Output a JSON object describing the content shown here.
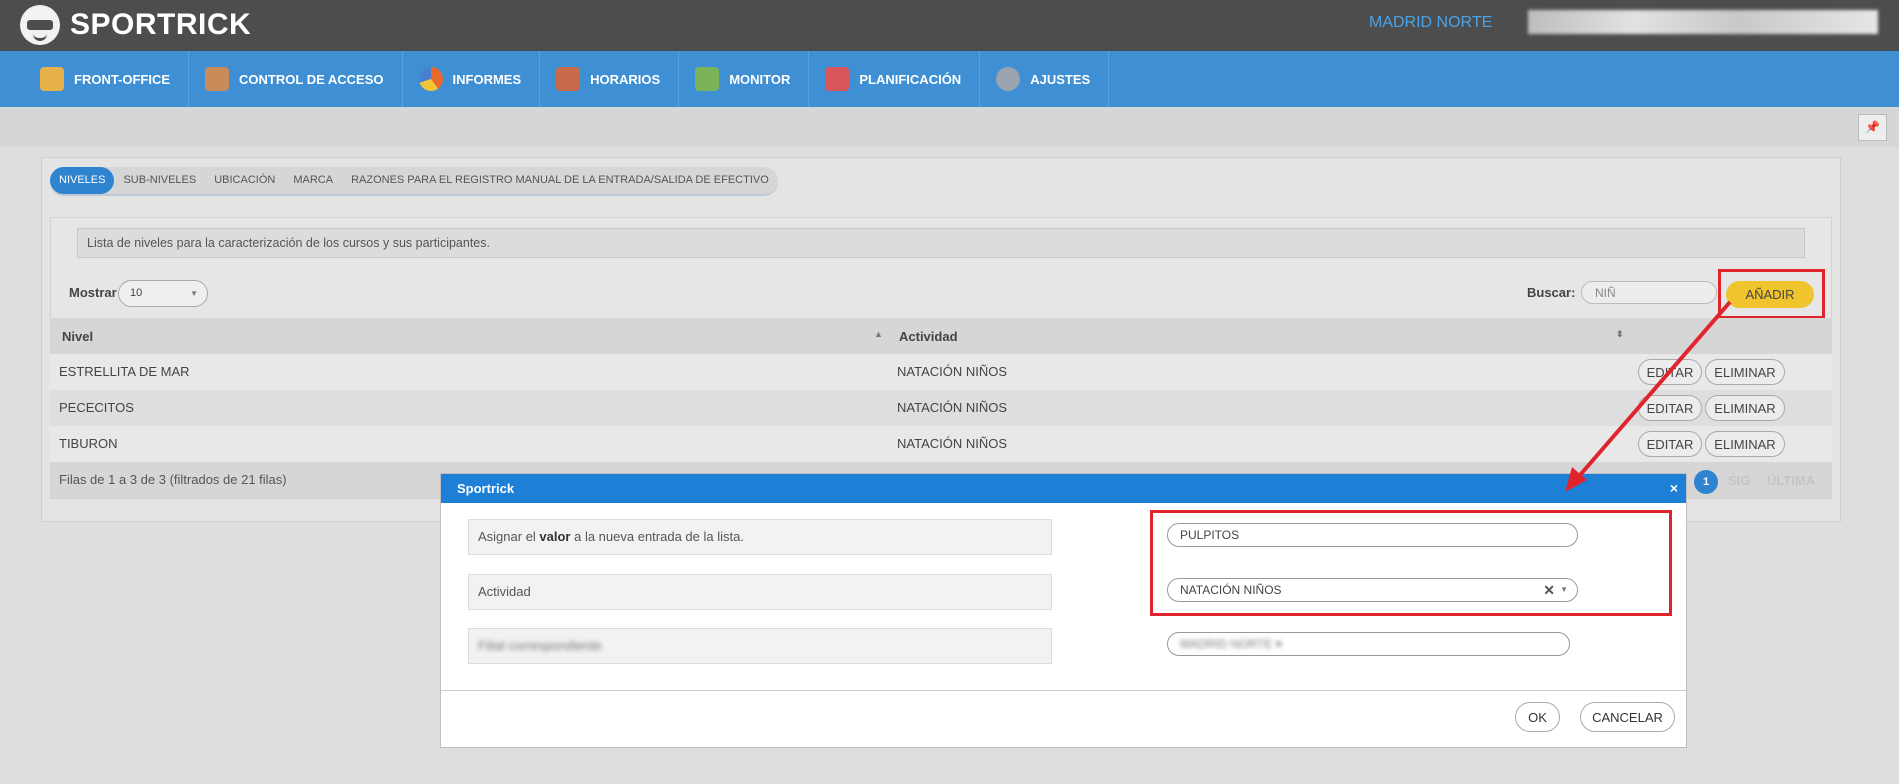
{
  "app": {
    "name": "SPORTRICK",
    "branch": "MADRID NORTE"
  },
  "nav": [
    {
      "label": "FRONT-OFFICE",
      "icon": "front-office-icon",
      "color": "#e8b24a"
    },
    {
      "label": "CONTROL DE ACCESO",
      "icon": "access-control-icon",
      "color": "#c98b5a"
    },
    {
      "label": "INFORMES",
      "icon": "pie-chart-icon",
      "color": "#e86a2b"
    },
    {
      "label": "HORARIOS",
      "icon": "schedule-board-icon",
      "color": "#c76b4a"
    },
    {
      "label": "MONITOR",
      "icon": "monitor-people-icon",
      "color": "#7bb35a"
    },
    {
      "label": "PLANIFICACIÓN",
      "icon": "calendar-icon",
      "color": "#d8565a"
    },
    {
      "label": "AJUSTES",
      "icon": "settings-gear-icon",
      "color": "#9aa4ae"
    }
  ],
  "tabs": [
    "NIVELES",
    "SUB-NIVELES",
    "UBICACIÓN",
    "MARCA",
    "RAZONES PARA EL REGISTRO MANUAL DE LA ENTRADA/SALIDA DE EFECTIVO"
  ],
  "info": "Lista de niveles para la caracterización de los cursos y sus participantes.",
  "controls": {
    "show_label": "Mostrar",
    "show_value": "10",
    "search_label": "Buscar:",
    "search_value": "NIÑ",
    "add_label": "AÑADIR"
  },
  "table": {
    "headers": [
      "Nivel",
      "Actividad"
    ],
    "rows": [
      {
        "nivel": "ESTRELLITA DE MAR",
        "actividad": "NATACIÓN NIÑOS"
      },
      {
        "nivel": "PECECITOS",
        "actividad": "NATACIÓN NIÑOS"
      },
      {
        "nivel": "TIBURON",
        "actividad": "NATACIÓN NIÑOS"
      }
    ],
    "row_actions": {
      "edit": "EDITAR",
      "delete": "ELIMINAR"
    },
    "footer": "Filas de 1 a 3 de 3 (filtrados de 21 filas)",
    "pagination": {
      "current": "1",
      "next": "SIG",
      "last": "ÚLTIMA"
    }
  },
  "modal": {
    "title": "Sportrick",
    "close": "×",
    "field1_label_pre": "Asignar el ",
    "field1_label_bold": "valor",
    "field1_label_post": " a la nueva entrada de la lista.",
    "field1_value": "PULPITOS",
    "field2_label": "Actividad",
    "field2_value": "NATACIÓN NIÑOS",
    "field3_label": "Filial correspondiente",
    "field3_value": "MADRID NORTE ▾",
    "ok": "OK",
    "cancel": "CANCELAR"
  },
  "colors": {
    "highlight": "#e0242e",
    "nav": "#3e8fd3",
    "accent": "#f0c42d"
  }
}
